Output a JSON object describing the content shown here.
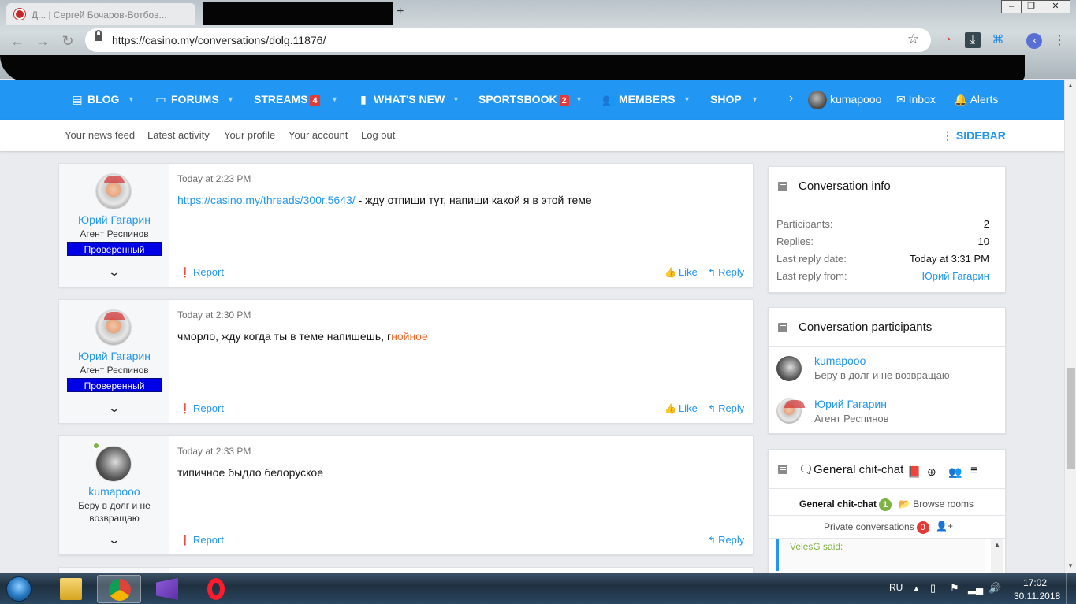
{
  "browser": {
    "tab_title": "Д... | Сергей Бочаров-Вотбов...",
    "new_tab": "+",
    "url": "https://casino.my/conversations/dolg.11876/",
    "window_buttons": [
      "‒",
      "❐",
      "✕"
    ],
    "profile_initial": "k"
  },
  "nav": {
    "items": [
      {
        "label": "BLOG",
        "icon": "blog-icon"
      },
      {
        "label": "FORUMS",
        "icon": "forums-icon"
      },
      {
        "label": "STREAMS",
        "badge": "4"
      },
      {
        "label": "WHAT'S NEW",
        "icon": "whats-new-icon"
      },
      {
        "label": "SPORTSBOOK",
        "badge": "2"
      },
      {
        "label": "MEMBERS",
        "icon": "members-icon"
      },
      {
        "label": "SHOP"
      }
    ],
    "more_chevron": "›",
    "username": "kumapooo",
    "inbox": "Inbox",
    "alerts": "Alerts"
  },
  "subnav": {
    "links": [
      "Your news feed",
      "Latest activity",
      "Your profile",
      "Your account",
      "Log out"
    ],
    "sidebar_toggle": "SIDEBAR"
  },
  "messages": [
    {
      "author": "Юрий Гагарин",
      "user_title": "Агент Респинов",
      "banner": "Проверенный",
      "time": "Today at 2:23 PM",
      "link": "https://casino.my/threads/300r.5643/",
      "text": " - жду отпиши тут, напиши какой я в этой теме",
      "report": "Report",
      "like": "Like",
      "reply": "Reply"
    },
    {
      "author": "Юрий Гагарин",
      "user_title": "Агент Респинов",
      "banner": "Проверенный",
      "time": "Today at 2:30 PM",
      "text_prefix": "чморло, жду когда ты в теме напишешь, г",
      "text_highlight": "нойное",
      "report": "Report",
      "like": "Like",
      "reply": "Reply"
    },
    {
      "author": "kumapooo",
      "user_title_line1": "Беру в долг и не",
      "user_title_line2": "возвращаю",
      "time": "Today at 2:33 PM",
      "text": "типичное быдло белоруское",
      "report": "Report",
      "reply": "Reply"
    }
  ],
  "conversation_info": {
    "title": "Conversation info",
    "rows": [
      {
        "label": "Participants:",
        "value": "2"
      },
      {
        "label": "Replies:",
        "value": "10"
      },
      {
        "label": "Last reply date:",
        "value": "Today at 3:31 PM"
      },
      {
        "label": "Last reply from:",
        "value": "Юрий Гагарин"
      }
    ]
  },
  "participants": {
    "title": "Conversation participants",
    "list": [
      {
        "name": "kumapooo",
        "title": "Беру в долг и не возвращаю"
      },
      {
        "name": "Юрий Гагарин",
        "title": "Агент Респинов"
      }
    ]
  },
  "chat": {
    "title": "General chit-chat",
    "room_tab": "General chit-chat",
    "room_count": "1",
    "browse_rooms": "Browse rooms",
    "private": "Private conversations",
    "private_count": "0",
    "quote_author": "VelesG said:"
  },
  "taskbar": {
    "lang": "RU",
    "time": "17:02",
    "date": "30.11.2018"
  },
  "colors": {
    "accent": "#2196f3",
    "badge_red": "#e53935",
    "banner_blue": "#0000e6",
    "online_green": "#7cb342",
    "highlight_orange": "#f06424"
  }
}
